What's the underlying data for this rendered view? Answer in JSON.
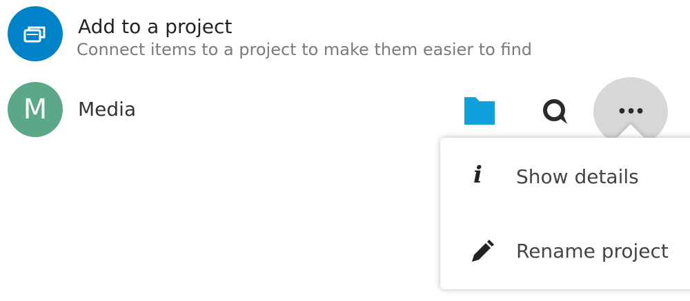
{
  "add_project": {
    "icon": "projects-icon",
    "title": "Add to a project",
    "subtitle": "Connect items to a project to make them easier to find"
  },
  "project": {
    "avatar_letter": "M",
    "name": "Media",
    "icons": [
      "folder-icon",
      "talk-icon",
      "more-icon"
    ],
    "more_label": "•••"
  },
  "menu": {
    "items": [
      {
        "icon": "info-icon",
        "glyph": "i",
        "label": "Show details"
      },
      {
        "icon": "pencil-icon",
        "label": "Rename project"
      }
    ]
  },
  "colors": {
    "primary": "#0082c9",
    "avatar": "#5ba889",
    "folder": "#0ea1dc",
    "more_bg": "#d7d7d7"
  }
}
